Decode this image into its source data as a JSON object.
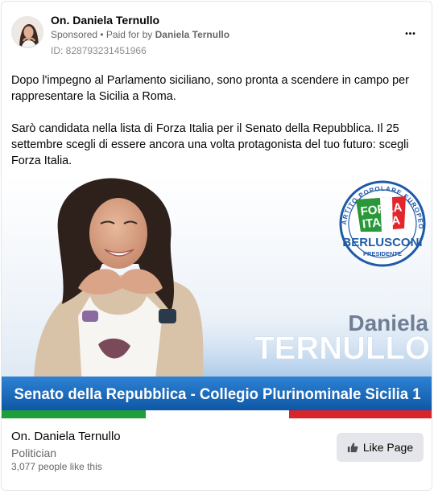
{
  "post": {
    "page_name": "On. Daniela Ternullo",
    "sponsored": "Sponsored",
    "separator": " • ",
    "paid_for_prefix": "Paid for by ",
    "paid_for_by": "Daniela Ternullo",
    "ad_id": "ID: 828793231451966",
    "more_label": "•••",
    "paragraphs": [
      "Dopo l'impegno al Parlamento siciliano, sono pronta a scendere in campo per rappresentare la Sicilia a Roma.",
      "Sarò candidata nella lista di Forza Italia per il Senato della Repubblica. Il 25 settembre scegli di essere ancora una volta protagonista del tuo futuro: scegli Forza Italia."
    ]
  },
  "creative": {
    "first_name": "Daniela",
    "last_name": "TERNULLO",
    "banner": "Senato della Repubblica - Collegio Plurinominale Sicilia 1",
    "logo": {
      "ring_text": "PARTITO POPOLARE EUROPEO",
      "party_line1": "FORZA",
      "party_line2": "ITALIA",
      "leader": "BERLUSCONI",
      "role": "PRESIDENTE"
    },
    "colors": {
      "banner_blue": "#1565b8",
      "flag_green": "#1e9e3a",
      "flag_red": "#d9242a",
      "logo_blue": "#1d5aa8",
      "logo_red": "#e2262c"
    }
  },
  "footer": {
    "page_name": "On. Daniela Ternullo",
    "category": "Politician",
    "likes": "3,077 people like this",
    "like_button": "Like Page"
  }
}
